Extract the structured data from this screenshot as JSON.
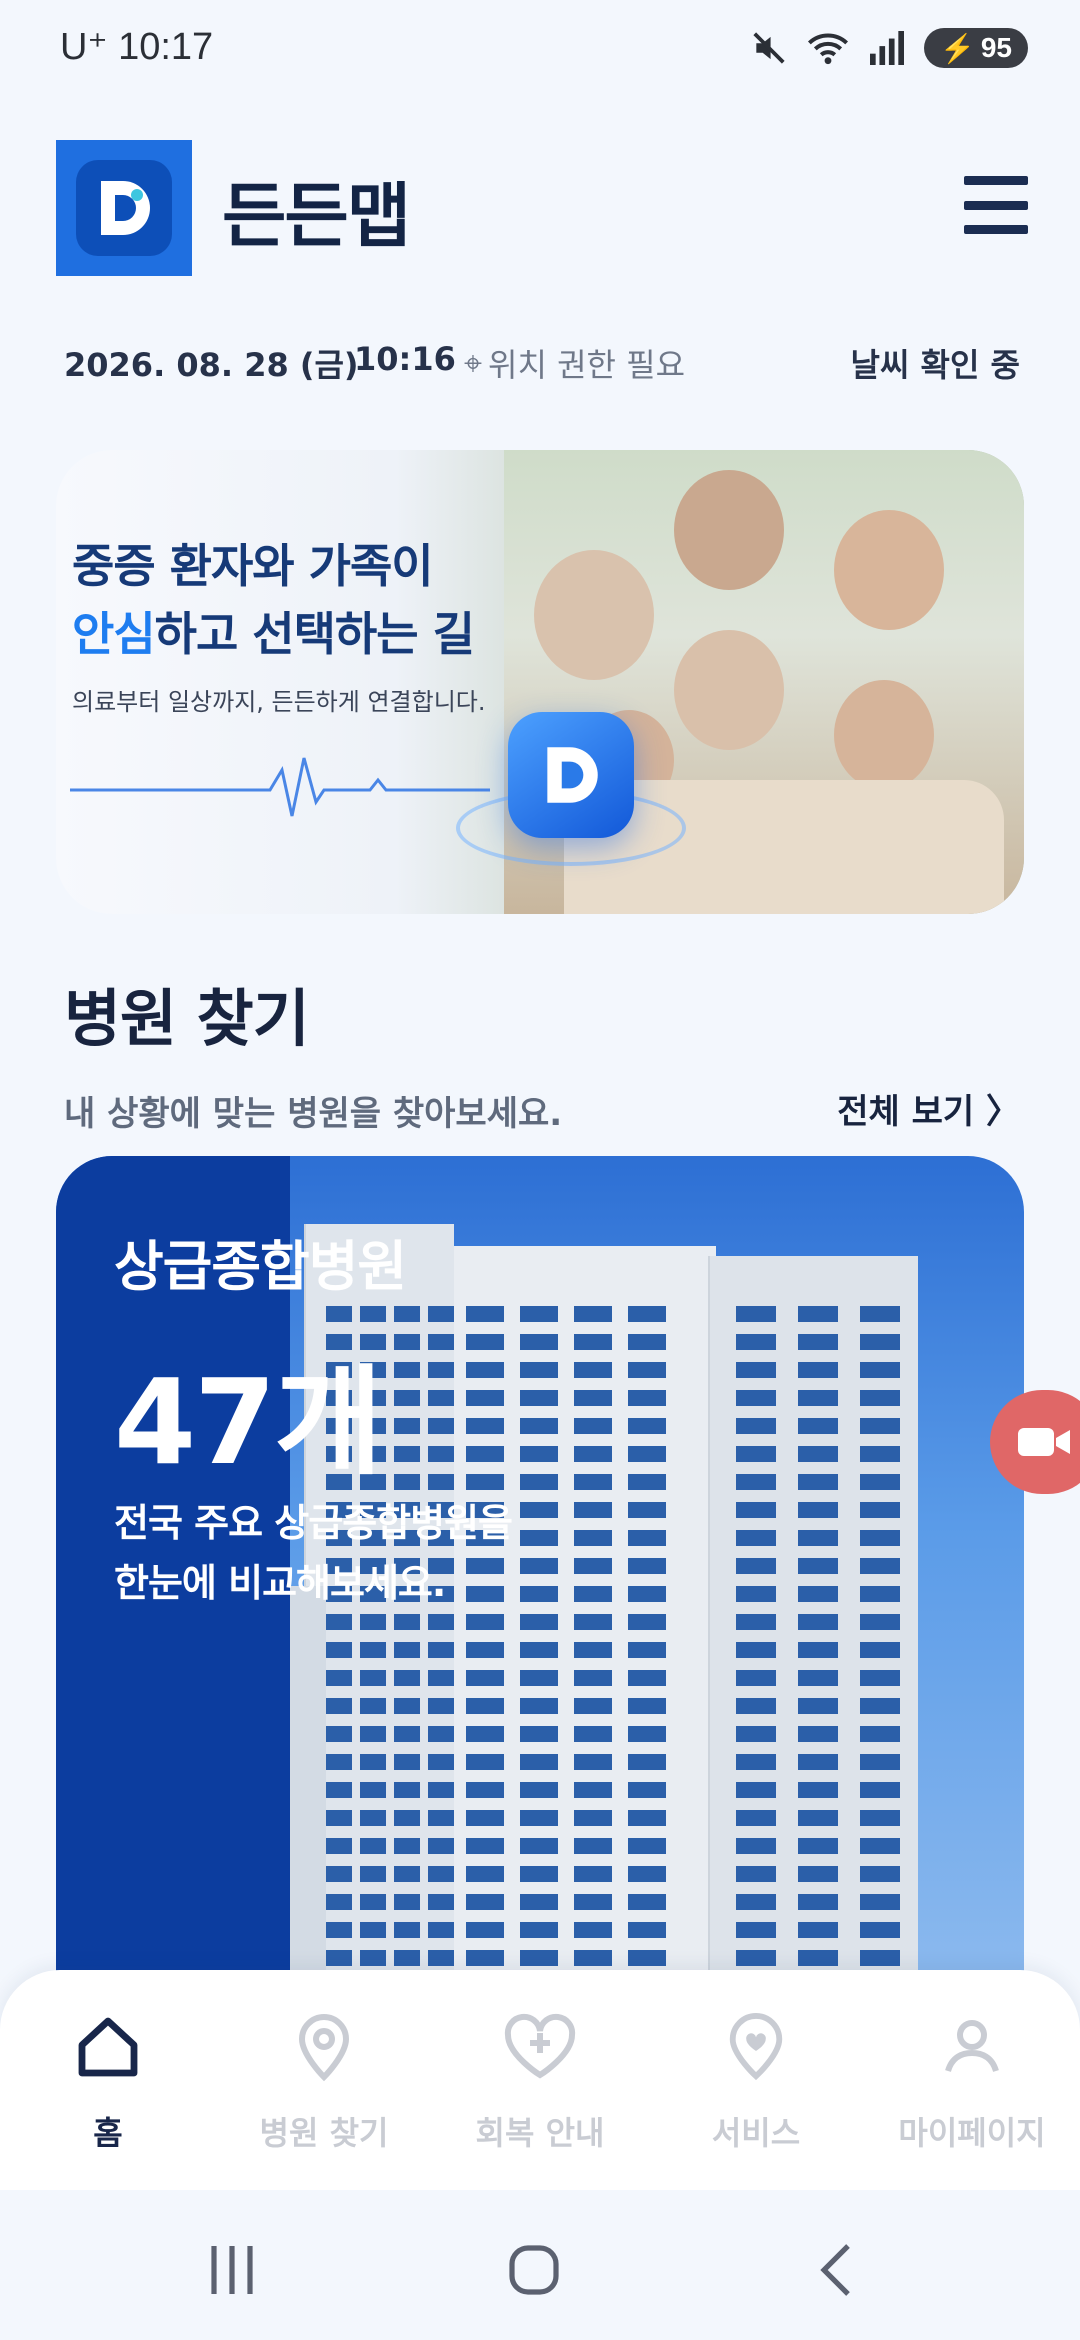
{
  "status_bar": {
    "carrier": "U⁺",
    "time": "10:17",
    "battery": "95",
    "icons": [
      "mute-icon",
      "wifi-icon",
      "signal-icon",
      "battery-icon"
    ]
  },
  "header": {
    "app_name": "든든맵",
    "logo_letter": "D"
  },
  "info": {
    "date": "2026. 08. 28 (금)",
    "time": "10:16",
    "location": "위치 권한 필요",
    "weather": "날씨 확인 중"
  },
  "hero": {
    "line1": "중증 환자와 가족이",
    "line2_highlight": "안심",
    "line2_rest": "하고 선택하는 길",
    "subtitle": "의료부터 일상까지, 든든하게 연결합니다.",
    "badge_letter": "D"
  },
  "section": {
    "title": "병원 찾기",
    "subtitle": "내 상황에 맞는 병원을 찾아보세요.",
    "see_all": "전체 보기 〉"
  },
  "hospital_card": {
    "title": "상급종합병원",
    "count": "47개",
    "desc_line1": "전국 주요 상급종합병원을",
    "desc_line2": "한눈에 비교해보세요."
  },
  "bottom_nav": {
    "items": [
      {
        "label": "홈",
        "icon": "home-icon",
        "active": true
      },
      {
        "label": "병원 찾기",
        "icon": "location-pin-icon",
        "active": false
      },
      {
        "label": "회복 안내",
        "icon": "heart-plus-icon",
        "active": false
      },
      {
        "label": "서비스",
        "icon": "heart-pin-icon",
        "active": false
      },
      {
        "label": "마이페이지",
        "icon": "user-icon",
        "active": false
      }
    ]
  },
  "colors": {
    "primary": "#1f6fe0",
    "navy": "#132445",
    "highlight": "#1e7df0",
    "card_panel": "#0c3d9f",
    "fab": "#e06767"
  }
}
